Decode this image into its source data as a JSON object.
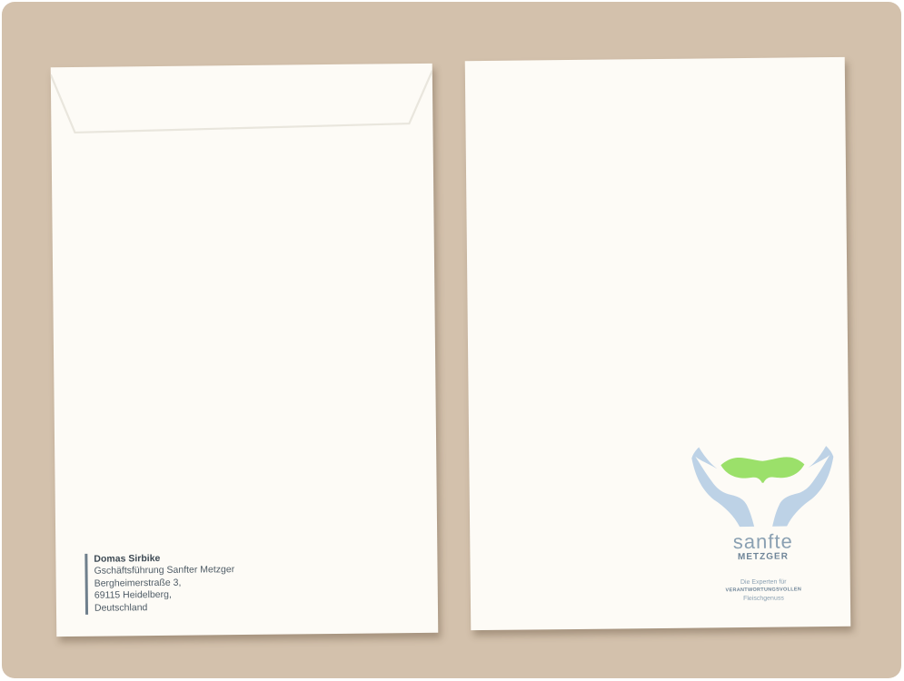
{
  "sender": {
    "name": "Domas Sirbike",
    "line1": "Gschäftsführung Sanfter Metzger",
    "line2": "Bergheimerstraße 3,",
    "line3": "69115 Heidelberg,",
    "line4": "Deutschland"
  },
  "brand": {
    "word1": "sanfte",
    "word2": "METZGER",
    "tagline1": "Die Experten für",
    "tagline2": "VERANTWORTUNGSVOLLEN",
    "tagline3": "Fleischgenuss"
  },
  "colors": {
    "background": "#d3c1ac",
    "envelope": "#fdfbf6",
    "hands": "#bdd2e6",
    "leaf": "#9be06a",
    "text": "#4f5c66"
  }
}
